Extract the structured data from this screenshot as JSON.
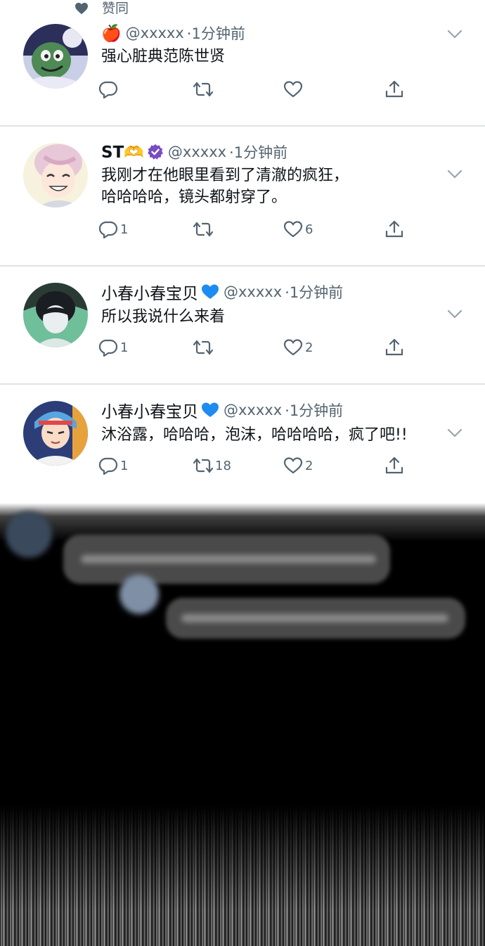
{
  "liked_label": "赞同",
  "colors": {
    "text_primary": "#0f1419",
    "text_secondary": "#536471",
    "divider": "#dfe3e6",
    "verified_purple": "#794bc4",
    "heart_blue": "#1d8cf0"
  },
  "tweets": [
    {
      "name": "🍎",
      "handle": "@xxxxx",
      "time": "·1分钟前",
      "text": "强心脏典范陈世贤",
      "text_line2": "",
      "reply_count": "",
      "retweet_count": "",
      "like_count": "",
      "badge": "apple-emoji"
    },
    {
      "name": "ST🫶",
      "handle": "@xxxxx",
      "time": "·1分钟前",
      "text": "我刚才在他眼里看到了清澈的疯狂，",
      "text_line2": "哈哈哈哈，镜头都射穿了。",
      "reply_count": "1",
      "retweet_count": "",
      "like_count": "6",
      "badge": "verified-check-icon"
    },
    {
      "name": "小春小春宝贝",
      "handle": "@xxxxx",
      "time": "·1分钟前",
      "text": "所以我说什么来着",
      "text_line2": "",
      "reply_count": "1",
      "retweet_count": "",
      "like_count": "2",
      "badge": "blue-heart-icon"
    },
    {
      "name": "小春小春宝贝",
      "handle": "@xxxxx",
      "time": "·1分钟前",
      "text": "沐浴露，哈哈哈，泡沫，哈哈哈哈，疯了吧!!",
      "text_line2": "",
      "reply_count": "1",
      "retweet_count": "18",
      "like_count": "2",
      "badge": "blue-heart-icon"
    }
  ]
}
